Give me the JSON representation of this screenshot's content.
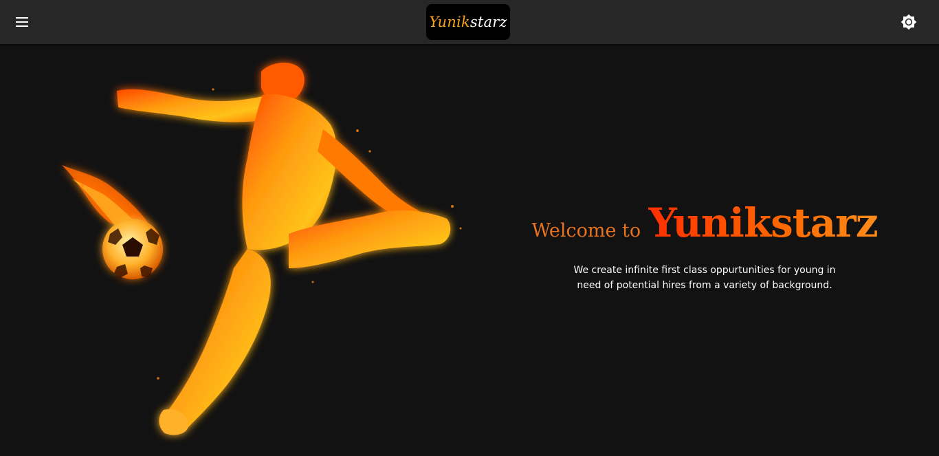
{
  "header": {
    "menu_icon": "hamburger-menu-icon",
    "logo": {
      "part1": "Yunik",
      "part2": "starz"
    },
    "theme_icon": "brightness-icon"
  },
  "hero": {
    "image": "fiery-soccer-player-kicking-flaming-ball",
    "welcome_prefix": "Welcome to",
    "brand": "Yunikstarz",
    "tagline": "We create infinite first class oppurtunities for young in need of potential hires from a variety of background."
  },
  "colors": {
    "background": "#121212",
    "topbar": "#272727",
    "accent_orange": "#f7a21b",
    "brand_red": "#ff3c00",
    "text": "#ffffff"
  }
}
